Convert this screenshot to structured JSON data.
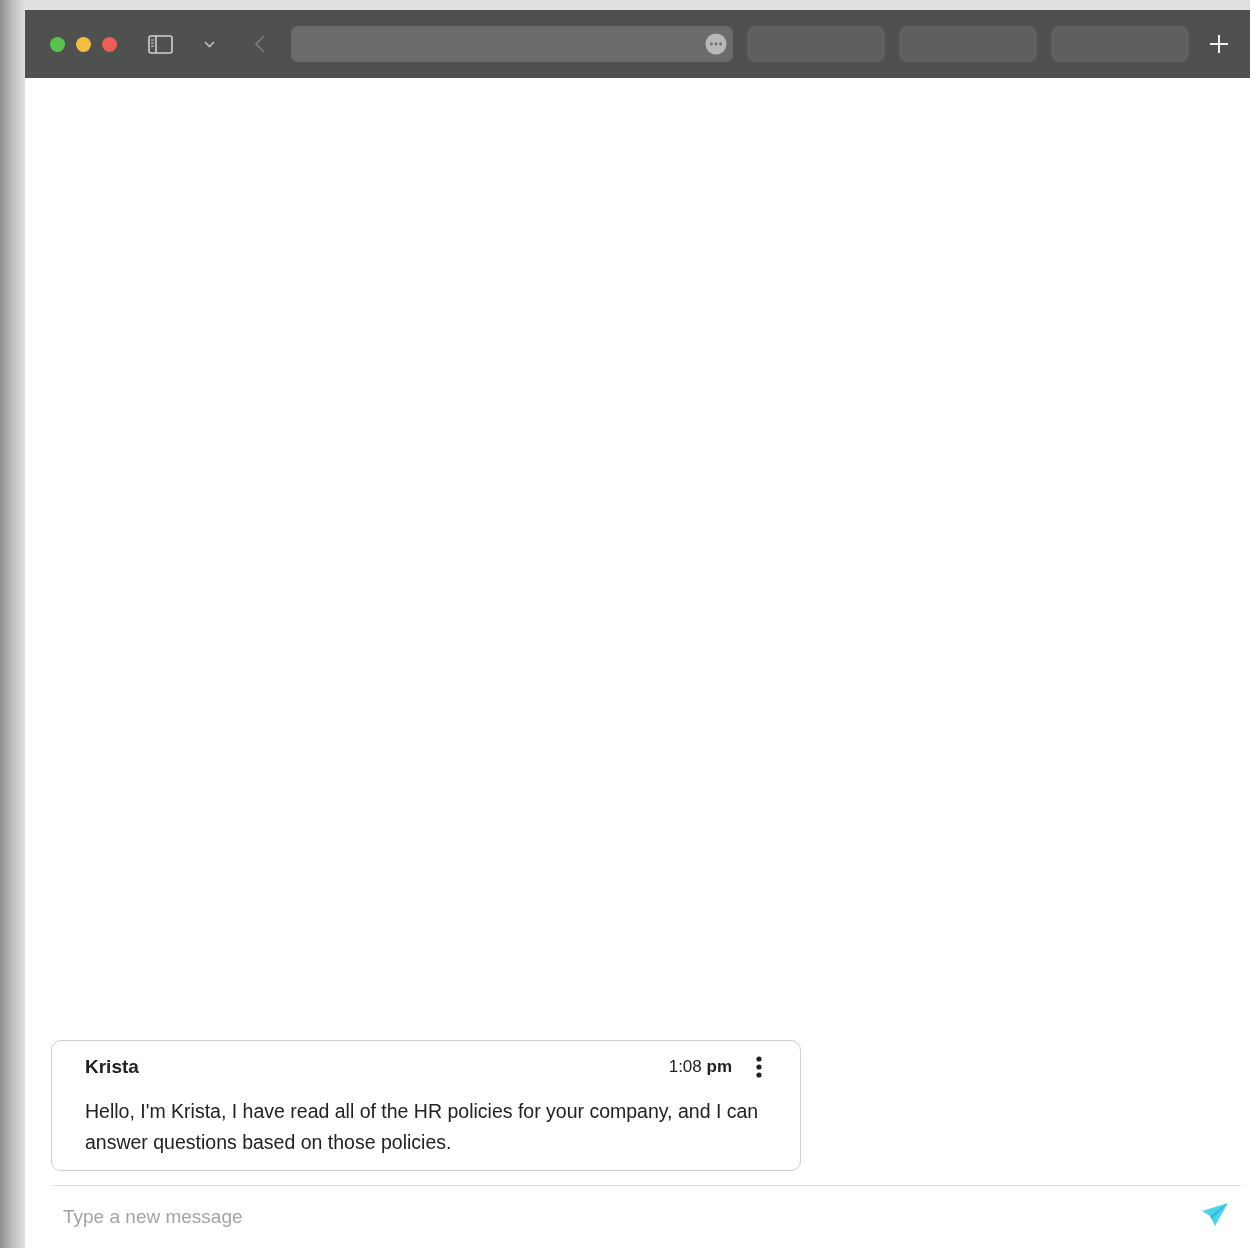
{
  "message": {
    "author": "Krista",
    "time": "1:08 **pm**",
    "text": "Hello, I'm Krista, I have read all of the HR policies for your company, and I can answer questions based on those policies."
  },
  "composer": {
    "placeholder": "Type a new message"
  }
}
